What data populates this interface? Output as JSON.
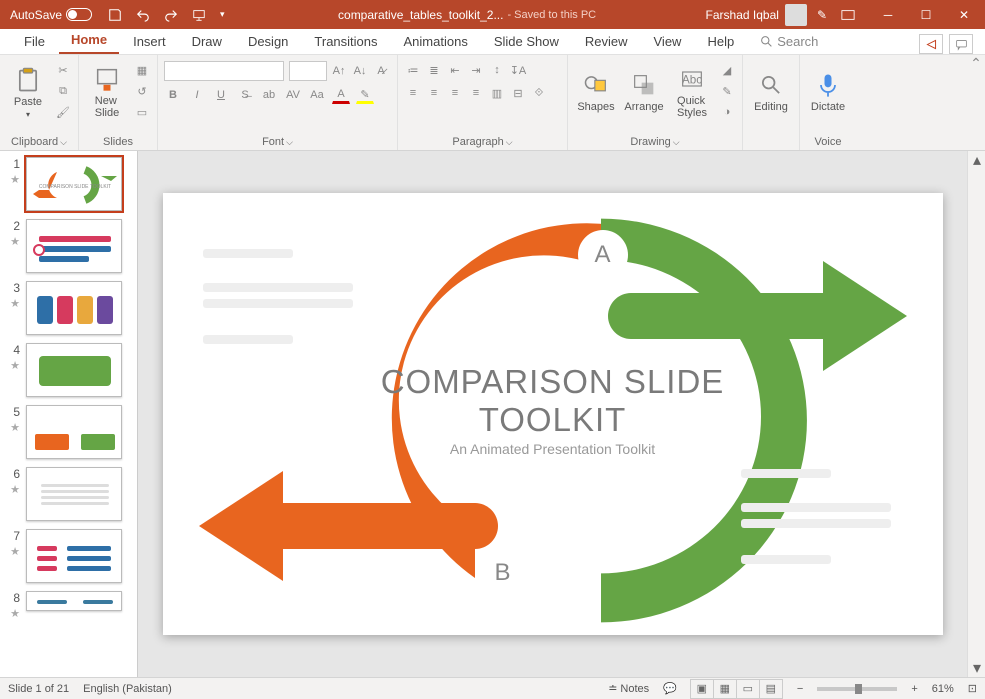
{
  "titlebar": {
    "autosave_label": "AutoSave",
    "filename": "comparative_tables_toolkit_2...",
    "saved_status": "- Saved to this PC",
    "user": "Farshad Iqbal"
  },
  "tabs": [
    "File",
    "Home",
    "Insert",
    "Draw",
    "Design",
    "Transitions",
    "Animations",
    "Slide Show",
    "Review",
    "View",
    "Help"
  ],
  "active_tab": "Home",
  "search": {
    "placeholder": "Search"
  },
  "ribbon": {
    "clipboard": {
      "paste": "Paste",
      "label": "Clipboard"
    },
    "slides": {
      "newslide": "New\nSlide",
      "label": "Slides"
    },
    "font": {
      "label": "Font"
    },
    "paragraph": {
      "label": "Paragraph"
    },
    "drawing": {
      "shapes": "Shapes",
      "arrange": "Arrange",
      "quickstyles": "Quick\nStyles",
      "label": "Drawing"
    },
    "editing": {
      "label": "Editing",
      "btn": "Editing"
    },
    "voice": {
      "dictate": "Dictate",
      "label": "Voice"
    }
  },
  "slide": {
    "title": "COMPARISON SLIDE TOOLKIT",
    "subtitle": "An Animated Presentation Toolkit",
    "labelA": "A",
    "labelB": "B"
  },
  "colors": {
    "orange": "#E8651F",
    "green": "#65A545"
  },
  "thumbnails": [
    1,
    2,
    3,
    4,
    5,
    6,
    7,
    8
  ],
  "selected_thumb": 1,
  "status": {
    "slide_of": "Slide 1 of 21",
    "language": "English (Pakistan)",
    "notes": "Notes",
    "zoom": "61%"
  }
}
